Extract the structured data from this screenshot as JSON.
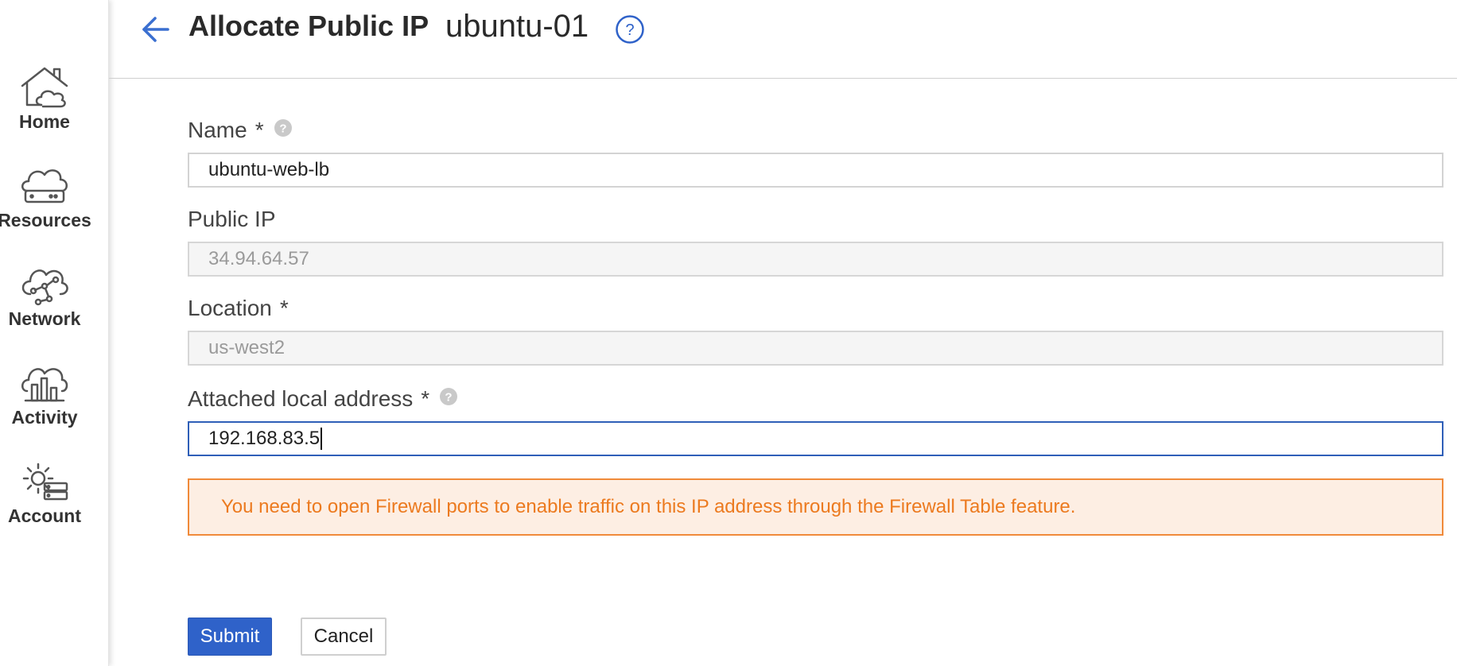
{
  "sidebar": {
    "items": [
      {
        "label": "Home",
        "icon": "home-cloud-icon"
      },
      {
        "label": "Resources",
        "icon": "cloud-server-icon"
      },
      {
        "label": "Network",
        "icon": "cloud-network-icon"
      },
      {
        "label": "Activity",
        "icon": "cloud-chart-icon"
      },
      {
        "label": "Account",
        "icon": "gear-server-icon"
      }
    ]
  },
  "header": {
    "title": "Allocate Public IP",
    "subtitle": "ubuntu-01",
    "help_icon": "help-circle-icon",
    "back_icon": "arrow-left-icon"
  },
  "form": {
    "name": {
      "label": "Name",
      "required_mark": "*",
      "value": "ubuntu-web-lb"
    },
    "public_ip": {
      "label": "Public IP",
      "value": "34.94.64.57"
    },
    "location": {
      "label": "Location",
      "required_mark": "*",
      "value": "us-west2"
    },
    "attached_local_address": {
      "label": "Attached local address",
      "required_mark": "*",
      "value": "192.168.83.5"
    }
  },
  "warning": {
    "text": "You need to open Firewall ports to enable traffic on this IP address through the Firewall Table feature."
  },
  "buttons": {
    "submit": "Submit",
    "cancel": "Cancel"
  },
  "colors": {
    "accent": "#2f62c9",
    "warning_text": "#ec7a1f",
    "warning_bg": "#fdeee3",
    "warning_border": "#f08a3a"
  }
}
